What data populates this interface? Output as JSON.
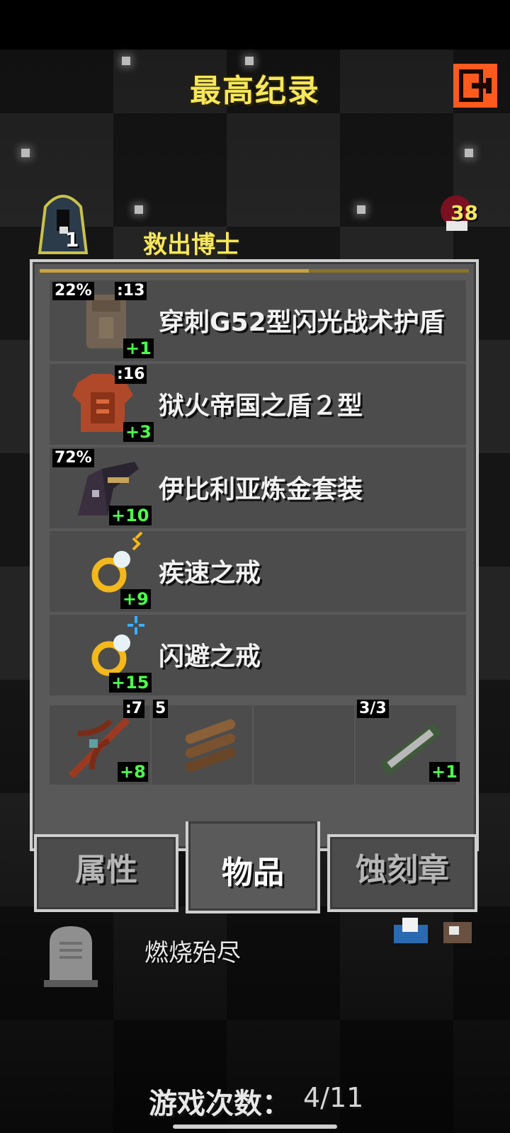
{
  "header": {
    "title": "最高纪录",
    "exit_icon": "exit-door-icon",
    "accent_color": "#f5e75a",
    "exit_color": "#ff5a1e"
  },
  "hero": {
    "badge": "1",
    "status": "救出博士",
    "enemy_level": "38"
  },
  "items": [
    {
      "name": "穿刺G52型闪光战术护盾",
      "top_left": "22%",
      "top_right": ":13",
      "level": "+1",
      "icon": "tactical-shield-icon"
    },
    {
      "name": "狱火帝国之盾２型",
      "top_left": "",
      "top_right": ":16",
      "level": "+3",
      "icon": "hellfire-shield-icon"
    },
    {
      "name": "伊比利亚炼金套装",
      "top_left": "72%",
      "top_right": "",
      "level": "+10",
      "icon": "alchemy-armor-icon"
    },
    {
      "name": "疾速之戒",
      "top_left": "",
      "top_right": "",
      "level": "+9",
      "icon": "haste-ring-icon"
    },
    {
      "name": "闪避之戒",
      "top_left": "",
      "top_right": "",
      "level": "+15",
      "icon": "evasion-ring-icon"
    }
  ],
  "quick_slots": [
    {
      "icon": "crossbow-weapon-icon",
      "top_right": ":7",
      "level": "+8"
    },
    {
      "icon": "logs-bundle-icon",
      "top_left": "5"
    },
    {
      "icon": "empty-slot"
    },
    {
      "icon": "wand-cannon-icon",
      "top_left": "3/3",
      "level": "+1"
    }
  ],
  "tabs": [
    {
      "label": "属性",
      "active": false
    },
    {
      "label": "物品",
      "active": true
    },
    {
      "label": "蚀刻章",
      "active": false
    }
  ],
  "death": {
    "cause": "燃烧殆尽"
  },
  "footer": {
    "games_label": "游戏次数：",
    "games_value": "4/11"
  }
}
